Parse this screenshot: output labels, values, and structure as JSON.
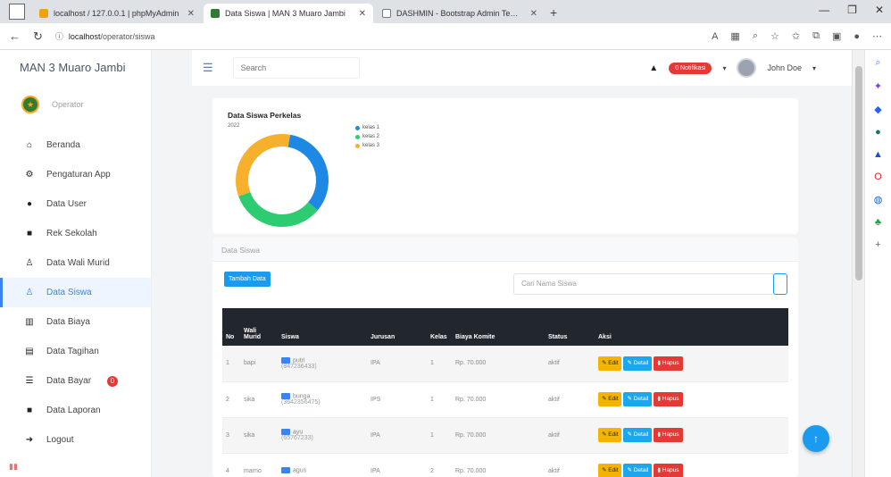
{
  "browser": {
    "tabs": [
      {
        "title": "localhost / 127.0.0.1 | phpMyAdmin",
        "color": "#f0a30a"
      },
      {
        "title": "Data Siswa | MAN 3 Muaro Jambi",
        "color": "#2e7d32"
      },
      {
        "title": "DASHMIN - Bootstrap Admin Template",
        "color": "#777777"
      }
    ],
    "url_host": "localhost",
    "url_path": "/operator/siswa"
  },
  "sidebar": {
    "brand": "MAN 3 Muaro Jambi",
    "role": "Operator",
    "items": [
      {
        "label": "Beranda",
        "icon": "home-icon",
        "glyph": "⌂"
      },
      {
        "label": "Pengaturan App",
        "icon": "gear-icon",
        "glyph": "⚙"
      },
      {
        "label": "Data User",
        "icon": "user-icon",
        "glyph": "●"
      },
      {
        "label": "Rek Sekolah",
        "icon": "book-icon",
        "glyph": "■"
      },
      {
        "label": "Data Wali Murid",
        "icon": "person-icon",
        "glyph": "♙"
      },
      {
        "label": "Data Siswa",
        "icon": "student-icon",
        "glyph": "♙"
      },
      {
        "label": "Data Biaya",
        "icon": "chart-icon",
        "glyph": "▥"
      },
      {
        "label": "Data Tagihan",
        "icon": "card-icon",
        "glyph": "▤"
      },
      {
        "label": "Data Bayar",
        "icon": "list-icon",
        "glyph": "☰",
        "badge": "0"
      },
      {
        "label": "Data Laporan",
        "icon": "report-icon",
        "glyph": "■"
      },
      {
        "label": "Logout",
        "icon": "logout-icon",
        "glyph": "➜"
      }
    ]
  },
  "topbar": {
    "search_placeholder": "Search",
    "notif_label": "0 Notifikasi",
    "user_name": "John Doe"
  },
  "chart_data": {
    "type": "pie",
    "title": "Data Siswa Perkelas",
    "subtitle": "2022",
    "categories": [
      "kelas 1",
      "kelas 2",
      "kelas 3"
    ],
    "values": [
      1,
      1,
      1
    ],
    "colors": [
      "#1e88e5",
      "#2ecc71",
      "#f6b02c"
    ],
    "donut": true,
    "legend_position": "right"
  },
  "list": {
    "card_title": "Data Siswa",
    "add_button": "Tambah Data",
    "search_placeholder": "Cari Nama Siswa",
    "columns": [
      "No",
      "Wali Murid",
      "Siswa",
      "Jurusan",
      "Kelas",
      "Biaya Komite",
      "Status",
      "Aksi"
    ],
    "rows": [
      {
        "no": "1",
        "wali": "bapi",
        "nama": "putri",
        "nisn": "(847236433)",
        "jurusan": "IPA",
        "kelas": "1",
        "biaya": "Rp. 70.000",
        "status": "aktif"
      },
      {
        "no": "2",
        "wali": "sika",
        "nama": "bunga",
        "nisn": "(3642356475)",
        "jurusan": "IPS",
        "kelas": "1",
        "biaya": "Rp. 70.000",
        "status": "aktif"
      },
      {
        "no": "3",
        "wali": "sika",
        "nama": "ayu",
        "nisn": "(65767233)",
        "jurusan": "IPA",
        "kelas": "1",
        "biaya": "Rp. 70.000",
        "status": "aktif"
      },
      {
        "no": "4",
        "wali": "marno",
        "nama": "agus",
        "nisn": "",
        "jurusan": "IPA",
        "kelas": "2",
        "biaya": "Rp. 70.000",
        "status": "aktif"
      }
    ],
    "actions": {
      "edit": "Edit",
      "detail": "Detail",
      "hapus": "Hapus"
    }
  }
}
